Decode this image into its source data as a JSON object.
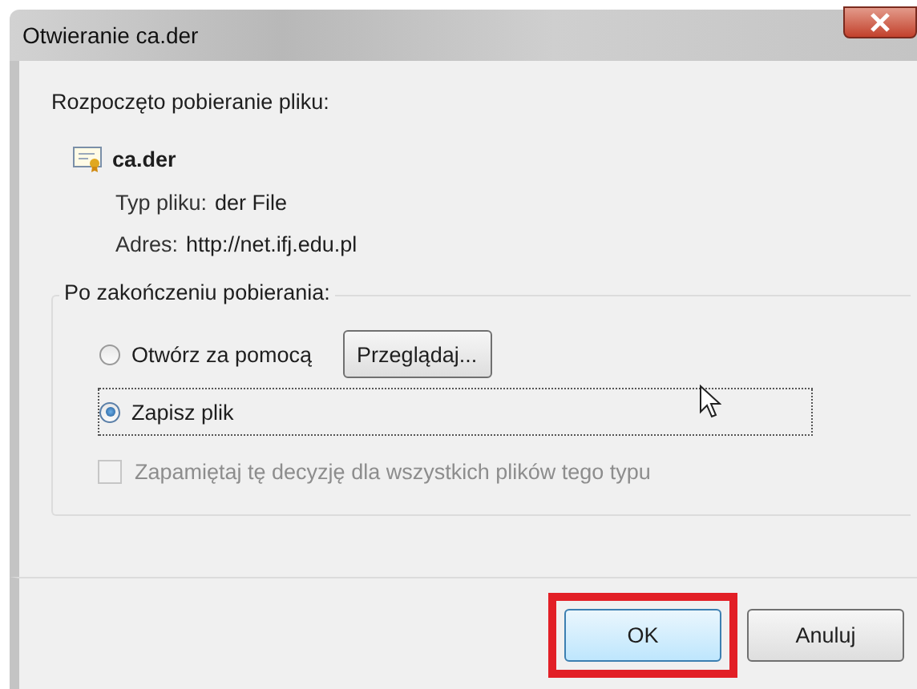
{
  "window": {
    "title": "Otwieranie ca.der"
  },
  "intro": "Rozpoczęto pobieranie pliku:",
  "file": {
    "name": "ca.der",
    "type_label": "Typ pliku:",
    "type_value": "der File",
    "address_label": "Adres:",
    "address_value": "http://net.ifj.edu.pl"
  },
  "group": {
    "legend": "Po zakończeniu pobierania:",
    "options": [
      {
        "label": "Otwórz za pomocą",
        "selected": false,
        "browse_button": "Przeglądaj..."
      },
      {
        "label": "Zapisz plik",
        "selected": true
      }
    ],
    "remember": {
      "label": "Zapamiętaj tę decyzję dla wszystkich plików tego typu",
      "checked": false,
      "disabled": true
    }
  },
  "buttons": [
    {
      "label": "OK",
      "highlighted": true
    },
    {
      "label": "Anuluj",
      "highlighted": false
    }
  ]
}
